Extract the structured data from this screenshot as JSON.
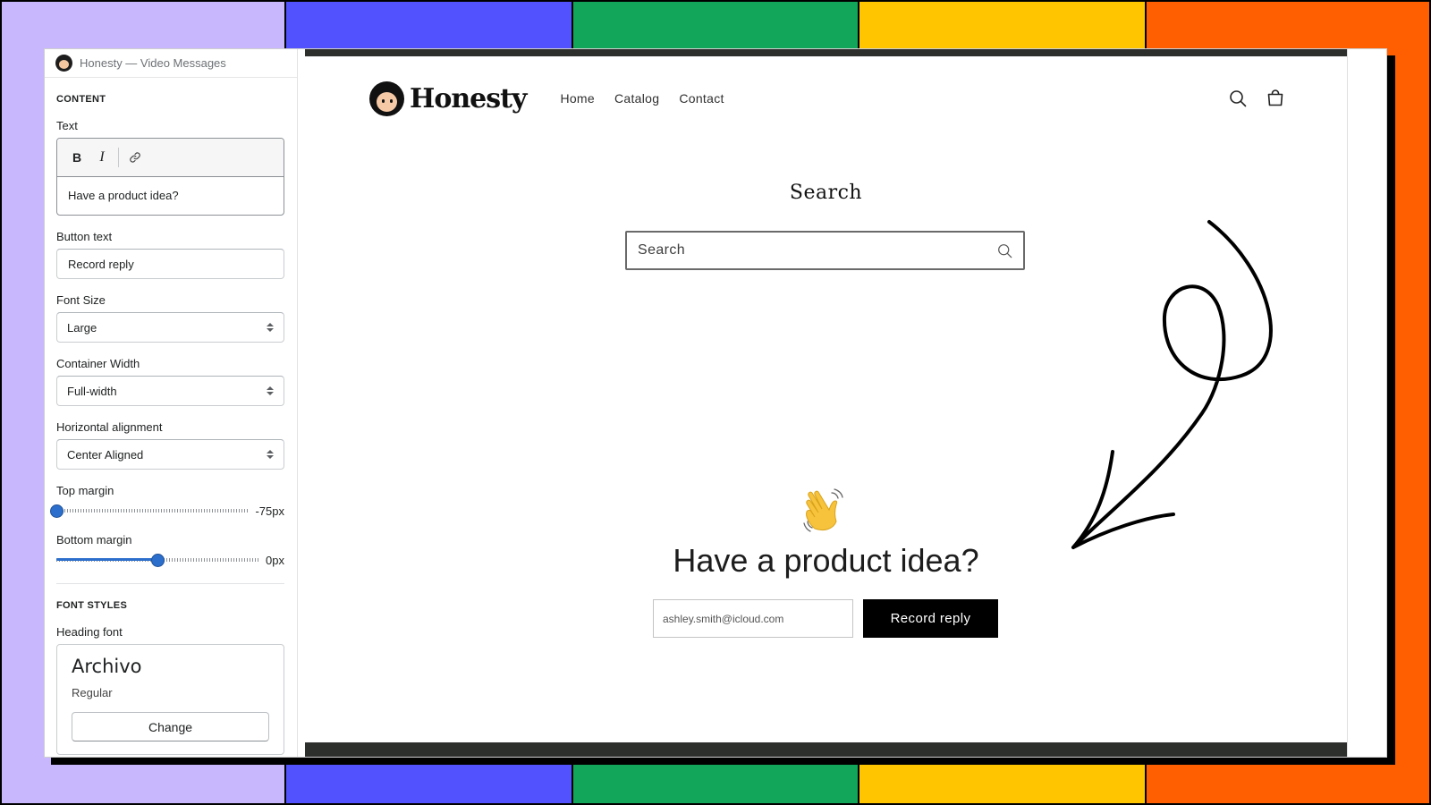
{
  "colors": {
    "stripes": [
      "#c8b7fc",
      "#5252ff",
      "#12a65a",
      "#ffc600",
      "#ff5f00"
    ],
    "accent": "#2c6ecb",
    "button": "#000000"
  },
  "app": {
    "title": "Honesty — Video Messages"
  },
  "sidebar": {
    "content_title": "CONTENT",
    "text_label": "Text",
    "toolbar": {
      "bold": "B",
      "italic": "I"
    },
    "text_value": "Have a product idea?",
    "button_text_label": "Button text",
    "button_text_value": "Record reply",
    "font_size_label": "Font Size",
    "font_size_value": "Large",
    "container_width_label": "Container Width",
    "container_width_value": "Full-width",
    "horizontal_alignment_label": "Horizontal alignment",
    "horizontal_alignment_value": "Center Aligned",
    "top_margin_label": "Top margin",
    "top_margin_value": "-75px",
    "top_margin_fraction": 0.0,
    "bottom_margin_label": "Bottom margin",
    "bottom_margin_value": "0px",
    "bottom_margin_fraction": 0.5,
    "font_styles_title": "FONT STYLES",
    "heading_font_label": "Heading font",
    "heading_font_name": "Archivo",
    "heading_font_style": "Regular",
    "change_label": "Change"
  },
  "store": {
    "brand": "Honesty",
    "nav": [
      "Home",
      "Catalog",
      "Contact"
    ],
    "search_title": "Search",
    "search_placeholder": "Search",
    "headline": "Have a product idea?",
    "email_value": "ashley.smith@icloud.com",
    "record_button": "Record reply"
  }
}
